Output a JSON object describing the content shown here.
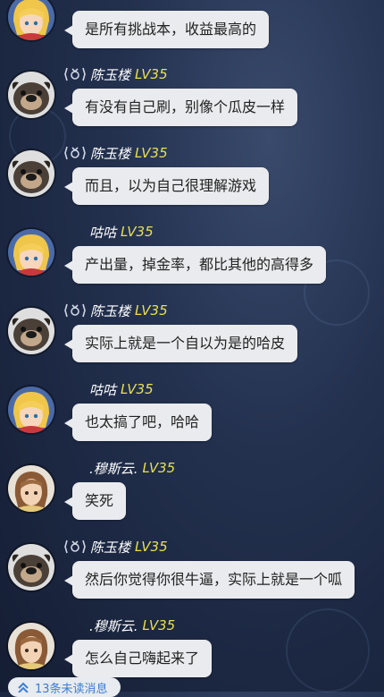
{
  "messages": [
    {
      "user": "",
      "level": "",
      "text": "是所有挑战本，收益最高的",
      "avatar": "blonde-girl-avatar",
      "vip": false
    },
    {
      "user": "陈玉楼",
      "level": "LV35",
      "text": "有没有自己刷，别像个瓜皮一样",
      "avatar": "pug-avatar",
      "vip": true
    },
    {
      "user": "陈玉楼",
      "level": "LV35",
      "text": "而且，以为自己很理解游戏",
      "avatar": "pug-avatar",
      "vip": true
    },
    {
      "user": "咕咕",
      "level": "LV35",
      "text": "产出量，掉金率，都比其他的高得多",
      "avatar": "blonde-girl-avatar",
      "vip": false
    },
    {
      "user": "陈玉楼",
      "level": "LV35",
      "text": "实际上就是一个自以为是的哈皮",
      "avatar": "pug-avatar",
      "vip": true
    },
    {
      "user": "咕咕",
      "level": "LV35",
      "text": "也太搞了吧，哈哈",
      "avatar": "blonde-girl-avatar",
      "vip": false
    },
    {
      "user": ".穆斯云.",
      "level": "LV35",
      "text": "笑死",
      "avatar": "brown-hair-avatar",
      "vip": false
    },
    {
      "user": "陈玉楼",
      "level": "LV35",
      "text": "然后你觉得你很牛逼，实际上就是一个呱",
      "avatar": "pug-avatar",
      "vip": true
    },
    {
      "user": ".穆斯云.",
      "level": "LV35",
      "text": "怎么自己嗨起来了",
      "avatar": "brown-hair-avatar",
      "vip": false
    }
  ],
  "unread": {
    "label": "13条未读消息",
    "icon": "double-chevron-up-icon"
  },
  "colors": {
    "bubble": "#e9ebee",
    "level": "#e7e052",
    "unread_text": "#3a7dd8"
  }
}
